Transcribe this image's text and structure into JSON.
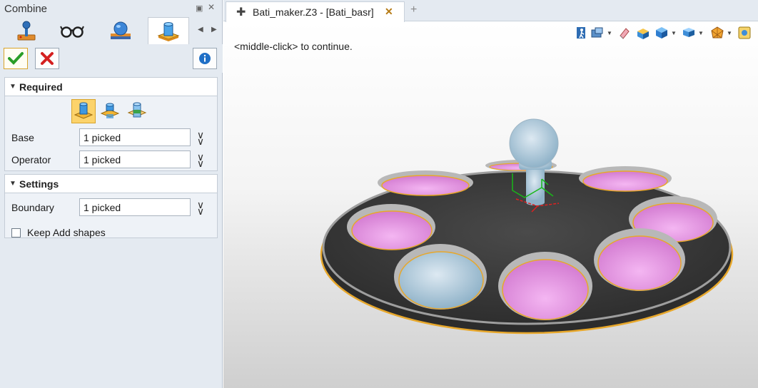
{
  "panel": {
    "title": "Combine",
    "mode_tabs": [
      {
        "icon": "joystick-icon"
      },
      {
        "icon": "glasses-icon"
      },
      {
        "icon": "sphere-on-plate-icon"
      },
      {
        "icon": "combine-shapes-icon"
      }
    ],
    "active_tab": 3,
    "buttons": {
      "ok_icon": "check-icon",
      "cancel_icon": "cross-icon",
      "info_icon": "info-icon"
    },
    "required": {
      "header": "Required",
      "combine_types": [
        "combine-add-icon",
        "combine-remove-icon",
        "combine-intersect-icon"
      ],
      "selected_type": 0,
      "base_label": "Base",
      "base_value": "1 picked",
      "operator_label": "Operator",
      "operator_value": "1 picked"
    },
    "settings": {
      "header": "Settings",
      "boundary_label": "Boundary",
      "boundary_value": "1 picked",
      "keep_label": "Keep Add shapes",
      "keep_checked": false
    }
  },
  "document": {
    "tab_title": "Bati_maker.Z3 - [Bati_basr]",
    "prompt": "<middle-click> to continue.",
    "toolbar_icons": [
      "exit-icon",
      "view-dropdown-icon",
      "eraser-icon",
      "box-icon",
      "cube-dropdown-icon",
      "render-dropdown-icon",
      "display-dropdown-icon",
      "settings-icon"
    ]
  },
  "colors": {
    "accent": "#d8a42c",
    "cavity": "#e69ae4",
    "plate": "#3b3b3b",
    "panel_bg": "#e4eaf1"
  }
}
